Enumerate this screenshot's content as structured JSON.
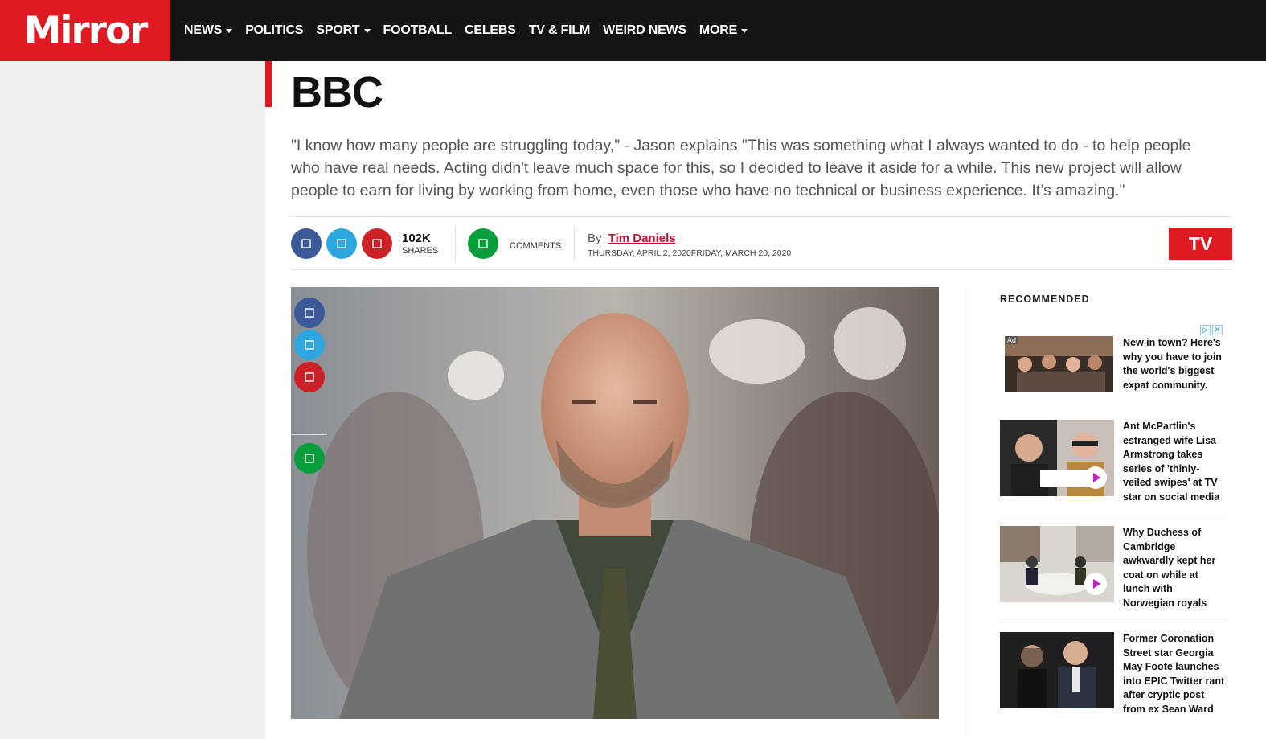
{
  "header": {
    "logo": "Mirror",
    "nav": [
      {
        "label": "NEWS",
        "caret": true
      },
      {
        "label": "POLITICS",
        "caret": false
      },
      {
        "label": "SPORT",
        "caret": true
      },
      {
        "label": "FOOTBALL",
        "caret": false
      },
      {
        "label": "CELEBS",
        "caret": false
      },
      {
        "label": "TV & FILM",
        "caret": false
      },
      {
        "label": "WEIRD NEWS",
        "caret": false
      },
      {
        "label": "MORE",
        "caret": true
      }
    ]
  },
  "article": {
    "title": "BBC",
    "standfirst": "\"I know how many people are struggling today,\" - Jason explains \"This was something what I always wanted to do - to help people who have real needs. Acting didn't leave much space for this, so I decided to leave it aside for a while. This new project will allow people to earn for living by working from home, even those who have no technical or business experience. It’s amazing.\"",
    "shares_count": "102K",
    "shares_label": "SHARES",
    "comments_label": "COMMENTS",
    "by_label": "By",
    "author": "Tim Daniels",
    "dates": "THURSDAY, APRIL 2, 2020FRIDAY, MARCH 20, 2020",
    "section_badge": "TV"
  },
  "share_icons": {
    "facebook": "facebook-icon",
    "twitter": "twitter-icon",
    "pinterest": "pinterest-icon",
    "comments": "comment-icon"
  },
  "colors": {
    "brand_red": "#e01a22",
    "nav_bg": "#141414",
    "facebook": "#3b5998",
    "twitter": "#2ea7e0",
    "pinterest": "#cc2127",
    "comments": "#0a9d3c"
  },
  "sidebar": {
    "heading": "RECOMMENDED",
    "ad_label": "Ad",
    "items": [
      {
        "text": "New in town? Here's why you have to join the world's biggest expat community."
      },
      {
        "text": "Ant McPartlin's estranged wife Lisa Armstrong takes series of 'thinly-veiled swipes' at TV star on social media"
      },
      {
        "text": "Why Duchess of Cambridge awkwardly kept her coat on while at lunch with Norwegian royals"
      },
      {
        "text": "Former Coronation Street star Georgia May Foote launches into EPIC Twitter rant after cryptic post from ex Sean Ward"
      }
    ]
  }
}
